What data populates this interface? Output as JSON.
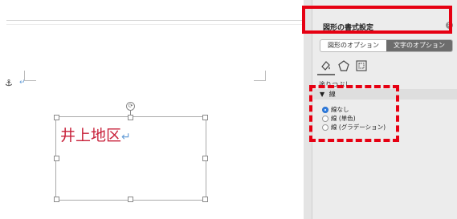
{
  "document": {
    "shape_text": "井上地区",
    "return_mark": "↵",
    "para_mark": "↵",
    "anchor_glyph": "⚓",
    "rotate_glyph": "⟳"
  },
  "panel": {
    "title": "図形の書式設定",
    "close_glyph": "✕",
    "tabs": [
      {
        "label": "図形のオプション",
        "active": false
      },
      {
        "label": "文字のオプション",
        "active": true
      }
    ],
    "icons": [
      "fill-line-icon",
      "shape-effects-icon",
      "layout-properties-icon"
    ],
    "fill_section_label": "塗りつぶし",
    "line_section": {
      "label": "線",
      "arrow": "▼",
      "options": [
        {
          "label": "線なし",
          "checked": true
        },
        {
          "label": "線 (単色)",
          "checked": false
        },
        {
          "label": "線 (グラデーション)",
          "checked": false
        }
      ]
    }
  },
  "annotation_color": "#e60012"
}
